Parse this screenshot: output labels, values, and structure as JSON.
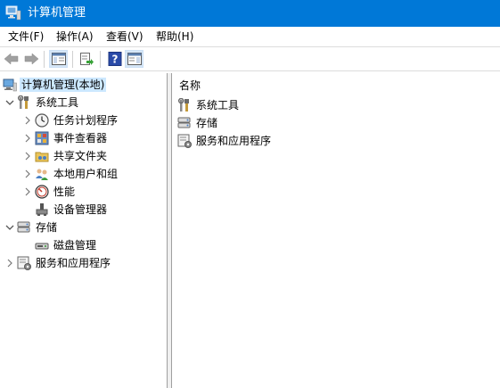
{
  "window": {
    "title": "计算机管理"
  },
  "menu": [
    "文件(F)",
    "操作(A)",
    "查看(V)",
    "帮助(H)"
  ],
  "toolbar": {
    "buttons": [
      "back-icon",
      "forward-icon",
      "show-hide-tree-icon",
      "export-list-icon",
      "help-icon",
      "show-hide-action-pane-icon"
    ]
  },
  "tree": {
    "root": "计算机管理(本地)",
    "system_tools": "系统工具",
    "task_scheduler": "任务计划程序",
    "event_viewer": "事件查看器",
    "shared_folders": "共享文件夹",
    "local_users": "本地用户和组",
    "performance": "性能",
    "device_manager": "设备管理器",
    "storage": "存储",
    "disk_management": "磁盘管理",
    "services_apps": "服务和应用程序"
  },
  "list": {
    "header": "名称",
    "items": [
      "系统工具",
      "存储",
      "服务和应用程序"
    ]
  },
  "colors": {
    "titlebar": "#0078d7",
    "selection": "#cce8ff",
    "toolbar_pressed": "#d5e6f7"
  }
}
